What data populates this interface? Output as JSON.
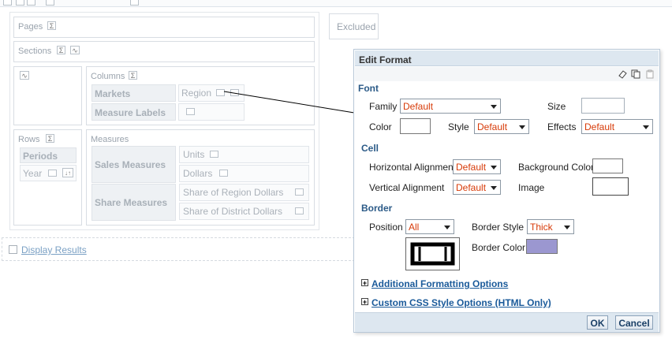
{
  "layout": {
    "excluded": "Excluded",
    "pages": "Pages",
    "sections": "Sections",
    "columns": "Columns",
    "rows": "Rows",
    "measures": "Measures",
    "markets": "Markets",
    "region": "Region",
    "measure_labels": "Measure Labels",
    "periods": "Periods",
    "year": "Year",
    "sales_measures": "Sales Measures",
    "units": "Units",
    "dollars": "Dollars",
    "share_measures": "Share Measures",
    "share_region_dollars": "Share of Region Dollars",
    "share_district_dollars": "Share of District Dollars",
    "display_results": "Display Results",
    "sigma": "Σ",
    "sort": "↓↑"
  },
  "dialog": {
    "title": "Edit Format",
    "font": {
      "heading": "Font",
      "family_label": "Family",
      "family_value": "Default",
      "size_label": "Size",
      "color_label": "Color",
      "style_label": "Style",
      "style_value": "Default",
      "effects_label": "Effects",
      "effects_value": "Default"
    },
    "cell": {
      "heading": "Cell",
      "halign_label": "Horizontal Alignment",
      "halign_value": "Default",
      "bgcolor_label": "Background Color",
      "valign_label": "Vertical Alignment",
      "valign_value": "Default",
      "image_label": "Image"
    },
    "border": {
      "heading": "Border",
      "position_label": "Position",
      "position_value": "All",
      "style_label": "Border Style",
      "style_value": "Thick",
      "color_label": "Border Color",
      "color_hex": "#9b97d0"
    },
    "additional_options": "Additional Formatting Options",
    "css_options": "Custom CSS Style Options (HTML Only)",
    "ok": "OK",
    "cancel": "Cancel"
  },
  "colors": {
    "accent": "#2b5a87",
    "dropdown_value": "#d73a08",
    "title_bar": "#dde7f0"
  }
}
